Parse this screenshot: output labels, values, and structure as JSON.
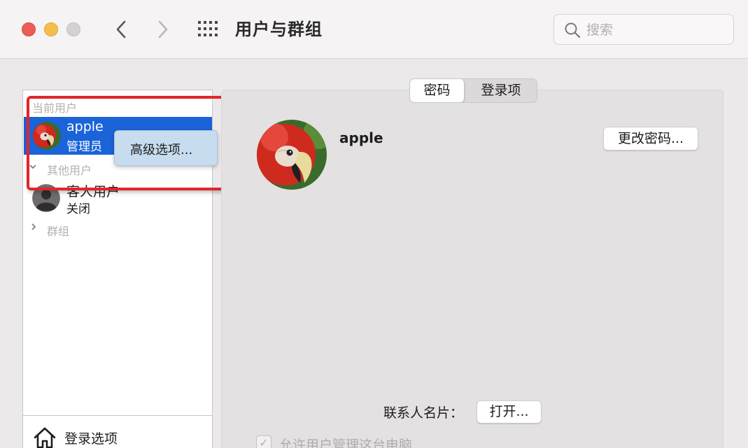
{
  "window": {
    "title": "用户与群组",
    "search_placeholder": "搜索"
  },
  "sidebar": {
    "current_users_label": "当前用户",
    "current_user": {
      "name": "apple",
      "role": "管理员"
    },
    "other_users_label": "其他用户",
    "guest_user": {
      "name": "客人用户",
      "status": "关闭"
    },
    "groups_label": "群组",
    "login_options_label": "登录选项"
  },
  "context_menu": {
    "item_label": "高级选项..."
  },
  "tabs": [
    {
      "label": "密码",
      "selected": true
    },
    {
      "label": "登录项",
      "selected": false
    }
  ],
  "main": {
    "user_name": "apple",
    "change_password_label": "更改密码...",
    "contact_card_label": "联系人名片：",
    "open_label": "打开...",
    "allow_admin_label": "允许用户管理这台电脑",
    "allow_admin_checked": true
  },
  "colors": {
    "selection": "#1a63d8",
    "highlight": "#e2252b",
    "close": "#ec5d58",
    "minimize": "#f4be4f"
  }
}
